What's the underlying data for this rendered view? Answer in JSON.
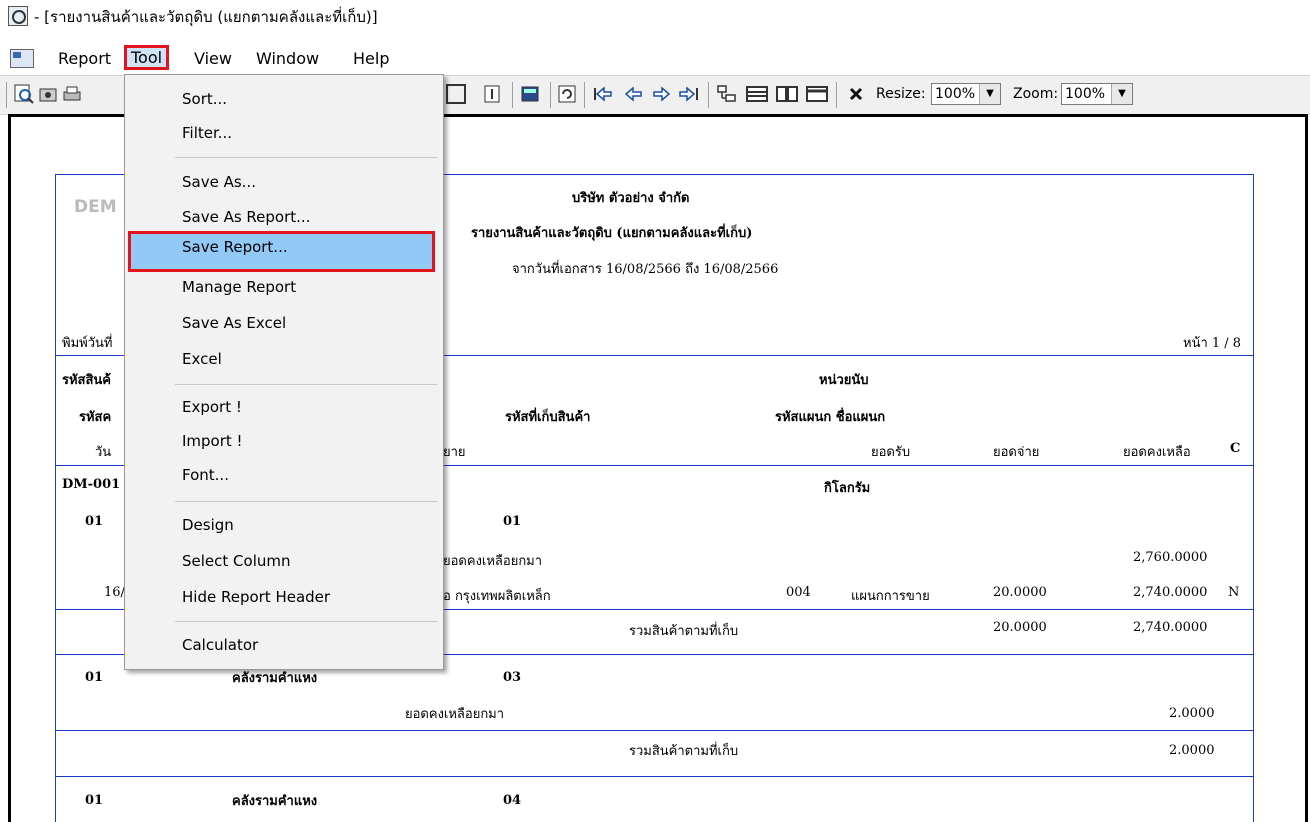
{
  "window": {
    "title": "- [รายงานสินค้าและวัตถุดิบ (แยกตามคลังและที่เก็บ)]"
  },
  "menubar": {
    "items": [
      "Report",
      "Tool",
      "View",
      "Window",
      "Help"
    ]
  },
  "toolbar": {
    "resize_label": "Resize:",
    "resize_value": "100%",
    "zoom_label": "Zoom:",
    "zoom_value": "100%"
  },
  "tool_menu": {
    "items": [
      "Sort...",
      "Filter...",
      "Save As...",
      "Save As Report...",
      "Save Report...",
      "Manage Report",
      "Save As Excel",
      "Excel",
      "Export !",
      "Import !",
      "Font...",
      "Design",
      "Select Column",
      "Hide Report Header",
      "Calculator"
    ],
    "highlighted": "Save Report..."
  },
  "report": {
    "watermark": "DEM",
    "company": "บริษัท ตัวอย่าง จำกัด",
    "title": "รายงานสินค้าและวัตถุดิบ (แยกตามคลังและที่เก็บ)",
    "date_range": "จากวันที่เอกสาร 16/08/2566 ถึง 16/08/2566",
    "print_date": "พิมพ์วันที่",
    "page": "หน้า 1 / 8",
    "headers": {
      "h1_col1": "รหัสสินค้",
      "h1_col2": "หน่วยนับ",
      "h2_col1": "รหัสค",
      "h2_col2": "รหัสที่เก็บสินค้า",
      "h2_col3": "รหัสแผนก ชื่อแผนก",
      "h3_col1": "วัน",
      "h3_col2": "ยาย",
      "h3_col3": "ยอดรับ",
      "h3_col4": "ยอดจ่าย",
      "h3_col5": "ยอดคงเหลือ",
      "h3_col6": "C"
    },
    "product_code": "DM-001",
    "product_unit": "กิโลกรัม",
    "group1": {
      "warehouse_code": "01",
      "location_code": "01",
      "brought_forward_label": "ยอดคงเหลือยกมา",
      "brought_forward_balance": "2,760.0000",
      "tx_date": "16/",
      "tx_desc": "อ กรุงเทพผลิตเหล็ก",
      "tx_dept_code": "004",
      "tx_dept_name": "แผนกการขาย",
      "tx_receive": "20.0000",
      "tx_balance": "2,740.0000",
      "tx_flag": "N",
      "subtotal_label": "รวมสินค้าตามที่เก็บ",
      "subtotal_receive": "20.0000",
      "subtotal_balance": "2,740.0000"
    },
    "group2": {
      "warehouse_code": "01",
      "warehouse_name": "คลังรามคำแหง",
      "location_code": "03",
      "brought_forward_label": "ยอดคงเหลือยกมา",
      "brought_forward_balance": "2.0000",
      "subtotal_label": "รวมสินค้าตามที่เก็บ",
      "subtotal_balance": "2.0000"
    },
    "group3": {
      "warehouse_code": "01",
      "warehouse_name": "คลังรามคำแหง",
      "location_code": "04"
    }
  }
}
